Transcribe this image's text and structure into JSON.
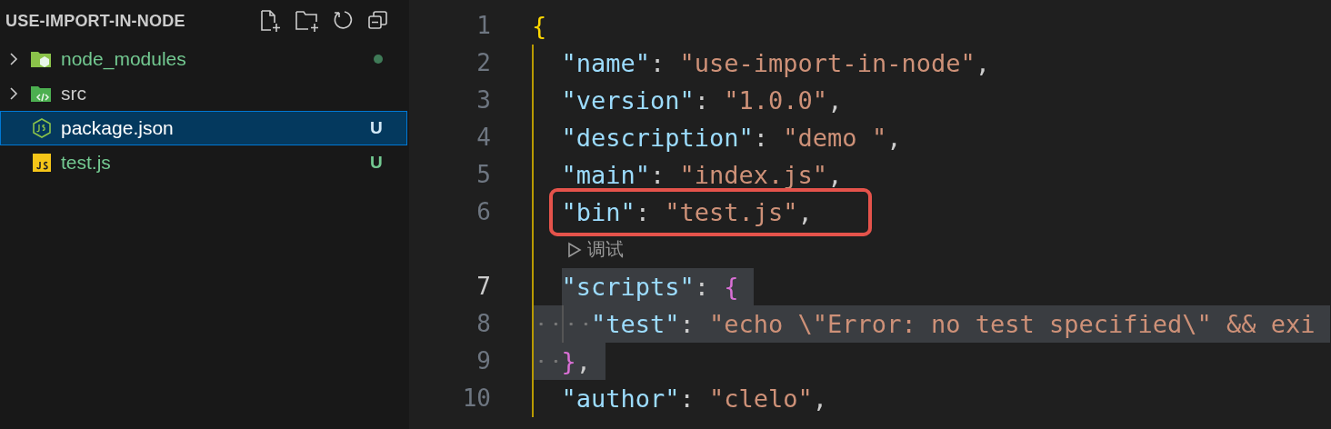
{
  "explorer": {
    "title": "USE-IMPORT-IN-NODE",
    "items": [
      {
        "name": "node_modules",
        "kind": "packages",
        "expanded": false,
        "selected": false,
        "color": "#73c991",
        "dot": true
      },
      {
        "name": "src",
        "kind": "source",
        "expanded": false,
        "selected": false,
        "color": "#cccccc",
        "dot": false
      },
      {
        "name": "package.json",
        "kind": "json",
        "selected": true,
        "color": "#ffffff",
        "dot": false,
        "status": "U"
      },
      {
        "name": "test.js",
        "kind": "script",
        "selected": false,
        "color": "#73c991",
        "dot": false,
        "status": "U"
      }
    ]
  },
  "editor": {
    "lines": [
      {
        "kind": "code",
        "number": "1",
        "current": false,
        "selected": false,
        "annotated": false,
        "tokens": [
          {
            "kind": "bracket1",
            "text": "{"
          }
        ],
        "children": [
          {
            "kind": "code",
            "number": "2",
            "current": false,
            "selected": false,
            "annotated": false,
            "tokens": [
              {
                "kind": "key",
                "text": "\"name\""
              },
              {
                "kind": "punct",
                "text": ": "
              },
              {
                "kind": "string",
                "text": "\"use-import-in-node\""
              },
              {
                "kind": "punct",
                "text": ","
              }
            ]
          },
          {
            "kind": "code",
            "number": "3",
            "current": false,
            "selected": false,
            "annotated": false,
            "tokens": [
              {
                "kind": "key",
                "text": "\"version\""
              },
              {
                "kind": "punct",
                "text": ": "
              },
              {
                "kind": "string",
                "text": "\"1.0.0\""
              },
              {
                "kind": "punct",
                "text": ","
              }
            ]
          },
          {
            "kind": "code",
            "number": "4",
            "current": false,
            "selected": false,
            "annotated": false,
            "tokens": [
              {
                "kind": "key",
                "text": "\"description\""
              },
              {
                "kind": "punct",
                "text": ": "
              },
              {
                "kind": "string",
                "text": "\"demo \""
              },
              {
                "kind": "punct",
                "text": ","
              }
            ]
          },
          {
            "kind": "code",
            "number": "5",
            "current": false,
            "selected": false,
            "annotated": false,
            "tokens": [
              {
                "kind": "key",
                "text": "\"main\""
              },
              {
                "kind": "punct",
                "text": ": "
              },
              {
                "kind": "string",
                "text": "\"index.js\""
              },
              {
                "kind": "punct",
                "text": ","
              }
            ]
          },
          {
            "kind": "code",
            "number": "6",
            "current": false,
            "selected": false,
            "annotated": true,
            "tokens": [
              {
                "kind": "key",
                "text": "\"bin\""
              },
              {
                "kind": "punct",
                "text": ": "
              },
              {
                "kind": "string",
                "text": "\"test.js\""
              },
              {
                "kind": "punct",
                "text": ","
              }
            ]
          },
          {
            "kind": "codelens",
            "label": "调试"
          },
          {
            "kind": "code",
            "number": "7",
            "current": true,
            "selected": true,
            "annotated": false,
            "tokens": [
              {
                "kind": "key",
                "text": "\"scripts\""
              },
              {
                "kind": "punct",
                "text": ": "
              },
              {
                "kind": "bracket2",
                "text": "{"
              }
            ],
            "children": [
              {
                "kind": "code",
                "number": "8",
                "current": false,
                "selected": true,
                "annotated": false,
                "tokens": [
                  {
                    "kind": "key",
                    "text": "\"test\""
                  },
                  {
                    "kind": "punct",
                    "text": ": "
                  },
                  {
                    "kind": "string",
                    "text": "\"echo \\\"Error: no test specified\\\" && exi"
                  }
                ]
              }
            ]
          },
          {
            "kind": "code",
            "number": "9",
            "current": false,
            "selected": true,
            "annotated": false,
            "tokens": [
              {
                "kind": "bracket2",
                "text": "}"
              },
              {
                "kind": "punct",
                "text": ","
              }
            ]
          },
          {
            "kind": "code",
            "number": "10",
            "current": false,
            "selected": false,
            "annotated": false,
            "tokens": [
              {
                "kind": "key",
                "text": "\"author\""
              },
              {
                "kind": "punct",
                "text": ": "
              },
              {
                "kind": "string",
                "text": "\"clelo\""
              },
              {
                "kind": "punct",
                "text": ","
              }
            ]
          }
        ]
      }
    ]
  }
}
